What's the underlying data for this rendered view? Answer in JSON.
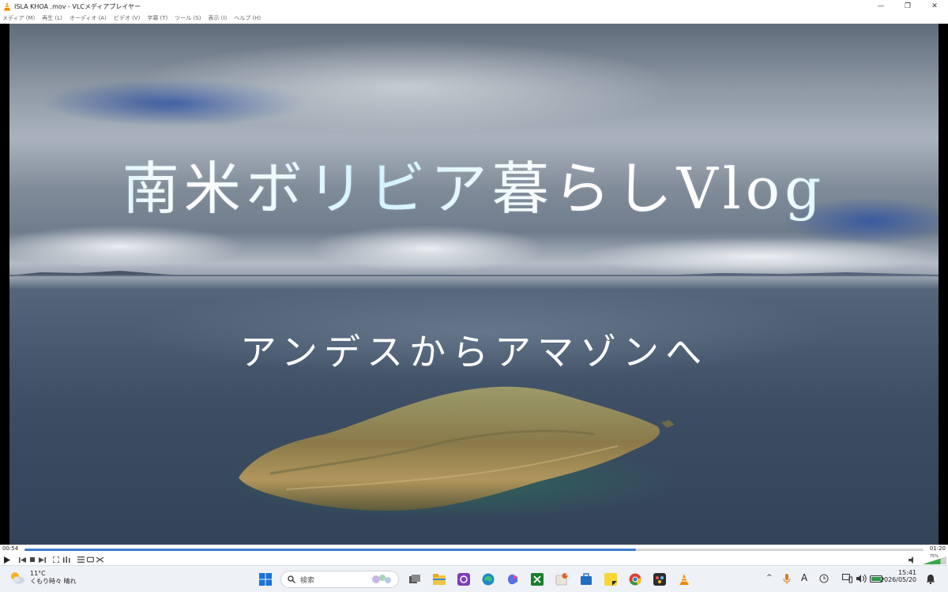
{
  "window": {
    "title": "ISLA KHOA .mov - VLCメディアプレイヤー",
    "minimize_glyph": "—",
    "maximize_glyph": "❐",
    "close_glyph": "✕"
  },
  "menu": {
    "items": [
      "メディア (M)",
      "再生 (L)",
      "オーディオ (A)",
      "ビデオ (V)",
      "字幕 (T)",
      "ツール (S)",
      "表示 (I)",
      "ヘルプ (H)"
    ]
  },
  "video": {
    "title": "南米ボリビア暮らしVlog",
    "subtitle": "アンデスからアマゾンへ"
  },
  "playback": {
    "current_time": "00:54",
    "total_time": "01:20",
    "progress": 0.68,
    "volume_percent": "75%",
    "volume_level": 0.75
  },
  "taskbar": {
    "weather_temp": "11°C",
    "weather_desc": "くもり時々 晴れ",
    "search_placeholder": "検索",
    "clock_time": "15:41",
    "clock_date": "2026/05/20",
    "ime_label": "A",
    "notification_count": "1"
  },
  "icons": {
    "app": "vlc-cone-icon",
    "start": "windows-start-icon",
    "taskbar_apps": [
      "task-view-icon",
      "file-explorer-icon",
      "app-purple-icon",
      "edge-icon",
      "m365-icon",
      "xbox-icon",
      "office-icon",
      "store-icon",
      "sticky-notes-icon",
      "chrome-icon",
      "davinci-icon",
      "vlc-taskbar-icon"
    ]
  },
  "colors": {
    "accent": "#3d7bd0",
    "vlc_orange": "#f08a00"
  }
}
